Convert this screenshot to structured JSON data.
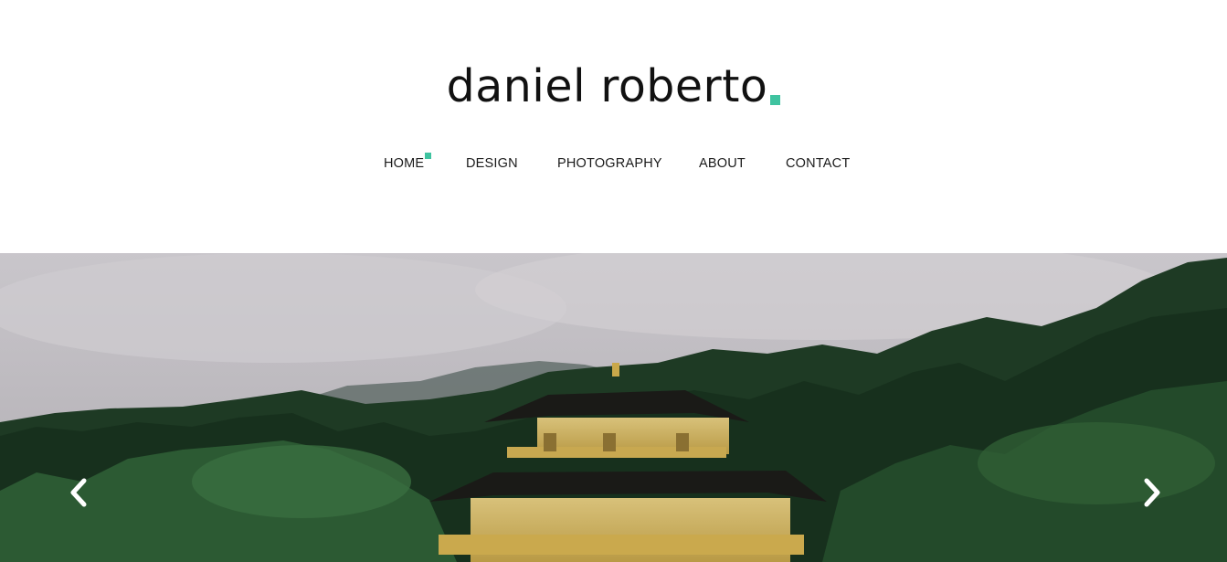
{
  "site": {
    "logo_text": "daniel roberto",
    "accent_color": "#3fc3a0"
  },
  "nav": {
    "items": [
      {
        "label": "HOME",
        "active": true
      },
      {
        "label": "DESIGN",
        "active": false
      },
      {
        "label": "PHOTOGRAPHY",
        "active": false
      },
      {
        "label": "ABOUT",
        "active": false
      },
      {
        "label": "CONTACT",
        "active": false
      }
    ]
  },
  "slider": {
    "prev_icon": "chevron-left-icon",
    "next_icon": "chevron-right-icon",
    "slide_subject": "golden pavilion among forest under misty sky"
  }
}
